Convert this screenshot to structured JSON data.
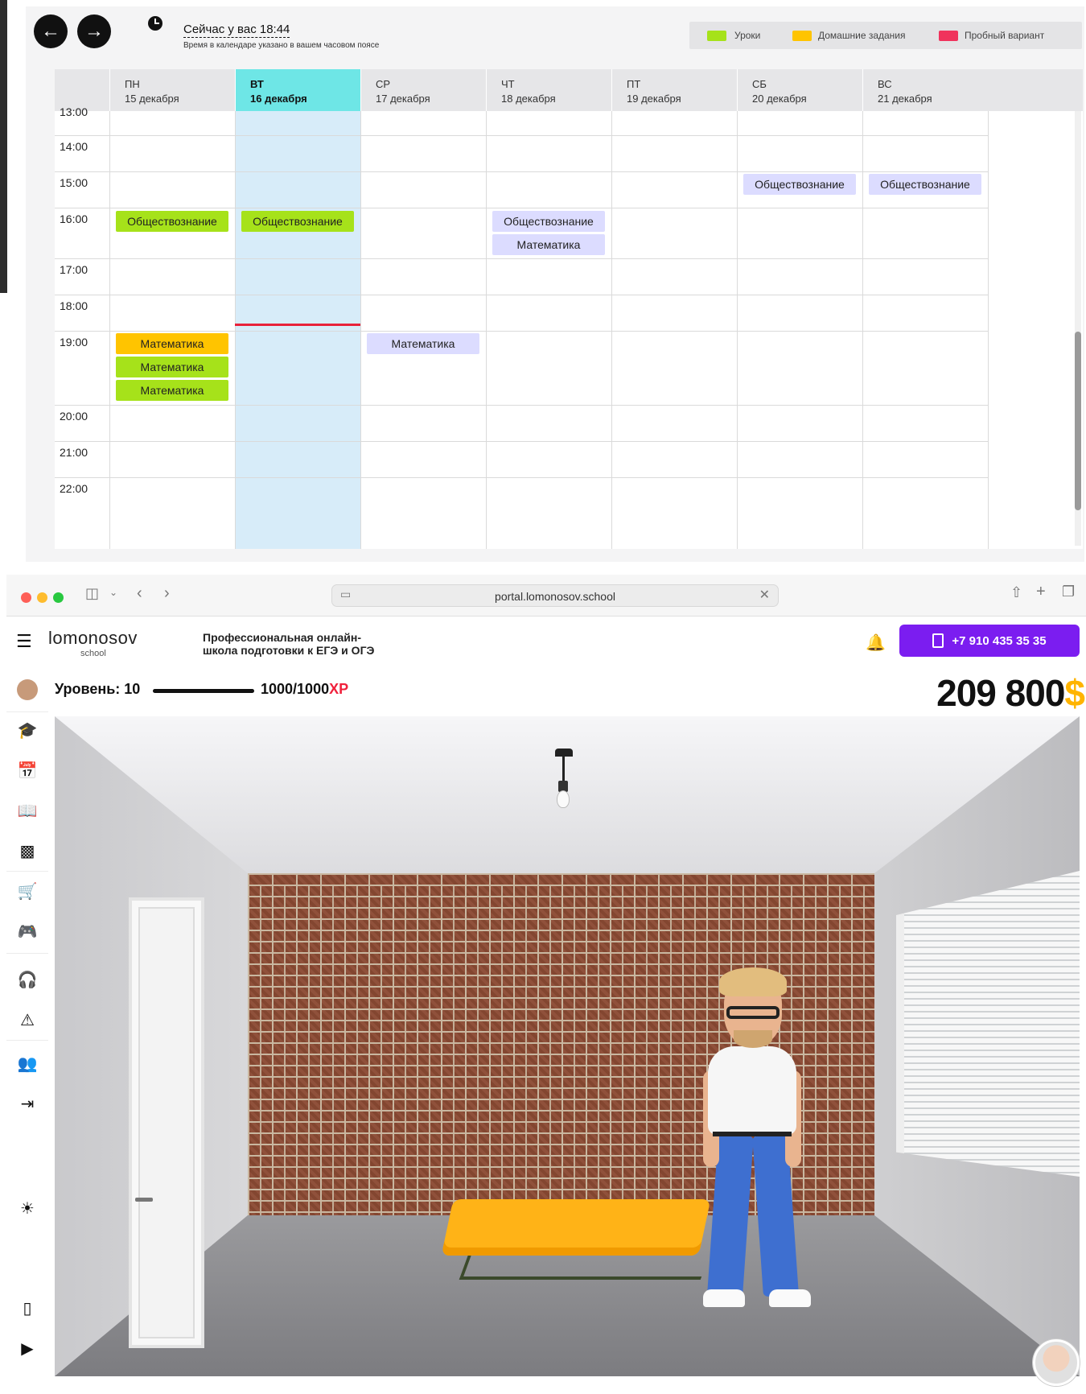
{
  "calendar": {
    "now_text": "Сейчас у вас 18:44",
    "tz_text": "Время в календаре указано в вашем часовом поясе",
    "legend": [
      {
        "label": "Уроки",
        "color": "#a6e21a"
      },
      {
        "label": "Домашние задания",
        "color": "#ffc400"
      },
      {
        "label": "Пробный вариант",
        "color": "#f0335c"
      }
    ],
    "days": [
      {
        "name": "ПН",
        "date": "15 декабря"
      },
      {
        "name": "ВТ",
        "date": "16 декабря"
      },
      {
        "name": "СР",
        "date": "17 декабря"
      },
      {
        "name": "ЧТ",
        "date": "18 декабря"
      },
      {
        "name": "ПТ",
        "date": "19 декабря"
      },
      {
        "name": "СБ",
        "date": "20 декабря"
      },
      {
        "name": "ВС",
        "date": "21 декабря"
      }
    ],
    "times": [
      "13:00",
      "14:00",
      "15:00",
      "16:00",
      "17:00",
      "18:00",
      "19:00",
      "20:00",
      "21:00",
      "22:00"
    ],
    "events": {
      "mon_1600": "Обществознание",
      "tue_1600": "Обществознание",
      "thu_1600": "Обществознание",
      "thu_1600b": "Математика",
      "sat_1500": "Обществознание",
      "sun_1500": "Обществознание",
      "mon_1900a": "Математика",
      "mon_1900b": "Математика",
      "mon_1900c": "Математика",
      "wed_1900": "Математика"
    }
  },
  "browser": {
    "url": "portal.lomonosov.school",
    "traffic_colors": [
      "#fe5f57",
      "#febc2e",
      "#28c840"
    ]
  },
  "site": {
    "logo": "lomonosov",
    "logo_sub": "school",
    "tagline_1": "Профессиональная онлайн-",
    "tagline_2": "школа подготовки к ЕГЭ и ОГЭ",
    "phone": "+7 910 435 35 35",
    "accent": "#7b1df0"
  },
  "game": {
    "level_label": "Уровень: 10",
    "xp_value": "1000/1000",
    "xp_unit": "XP",
    "xp_progress": 1.0,
    "coins": "209 800",
    "coin_sign": "$"
  },
  "sidebar_icons": [
    "profile-avatar",
    "graduation-cap-icon",
    "calendar-icon",
    "book-icon",
    "chart-icon",
    "cart-icon",
    "gamepad-icon",
    "headset-icon",
    "warning-icon",
    "users-icon",
    "logout-icon",
    "sun-icon",
    "phone-icon",
    "youtube-icon"
  ]
}
